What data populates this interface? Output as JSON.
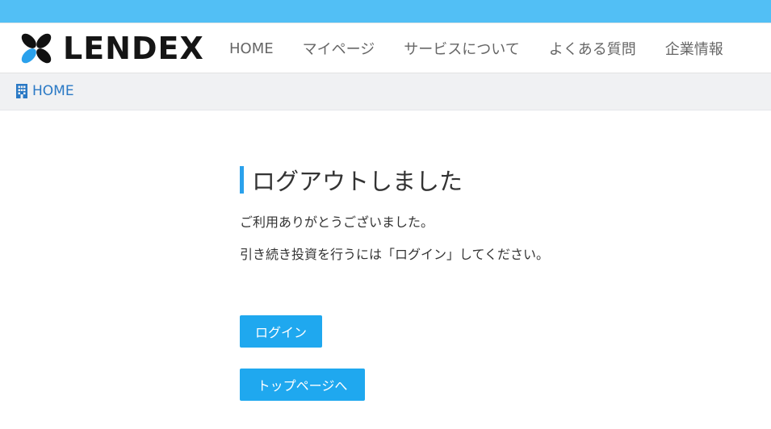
{
  "brand": {
    "logo_text": "LENDEX",
    "accent_color": "#52bff5",
    "button_color": "#1fa8ef",
    "link_color": "#2a79c5"
  },
  "nav": {
    "items": [
      {
        "label": "HOME"
      },
      {
        "label": "マイページ"
      },
      {
        "label": "サービスについて"
      },
      {
        "label": "よくある質問"
      },
      {
        "label": "企業情報"
      }
    ]
  },
  "breadcrumb": {
    "icon": "building-icon",
    "label": "HOME"
  },
  "main": {
    "title": "ログアウトしました",
    "message1": "ご利用ありがとうございました。",
    "message2": "引き続き投資を行うには「ログイン」してください。",
    "login_button": "ログイン",
    "top_button": "トップページへ"
  }
}
